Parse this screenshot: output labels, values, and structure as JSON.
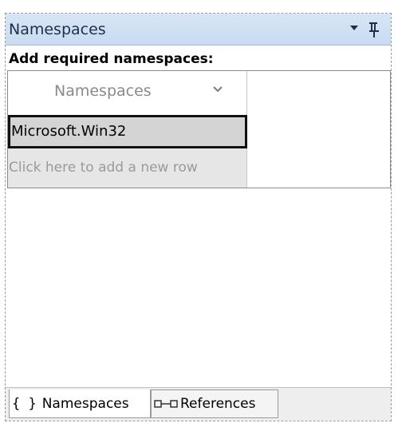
{
  "panel": {
    "title": "Namespaces"
  },
  "prompt": "Add required namespaces:",
  "grid": {
    "column_header": "Namespaces",
    "rows": [
      "Microsoft.Win32"
    ],
    "new_row_placeholder": "Click here to add a new row"
  },
  "tabs": [
    {
      "label": "Namespaces",
      "icon": "braces-icon",
      "icon_text": "{ }",
      "active": true
    },
    {
      "label": "References",
      "icon": "references-icon",
      "active": false
    }
  ],
  "colors": {
    "titlebar": "#c9dbf1",
    "selected_row": "#d4d4d4",
    "placeholder_row": "#e6e6e6"
  }
}
